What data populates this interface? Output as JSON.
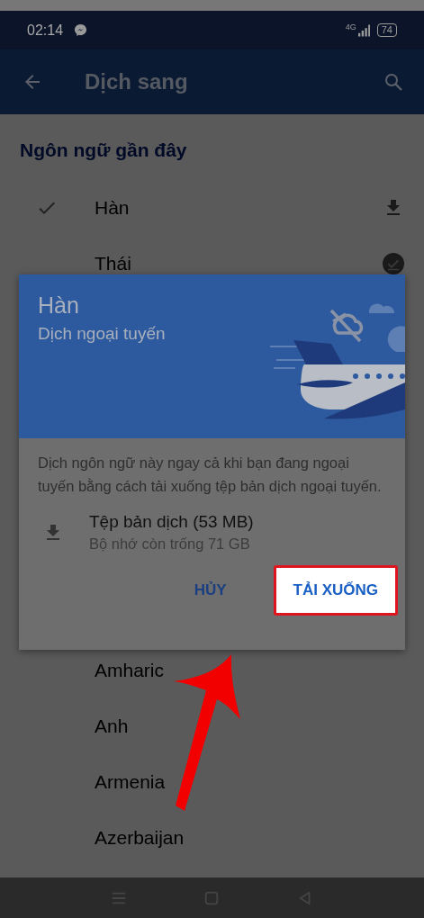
{
  "status_bar": {
    "time": "02:14",
    "network": "4G",
    "battery": "74"
  },
  "app_bar": {
    "title": "Dịch sang"
  },
  "recent_section": {
    "header": "Ngôn ngữ gần đây",
    "items": [
      {
        "name": "Hàn",
        "selected": true,
        "downloaded": false
      },
      {
        "name": "Thái",
        "selected": false,
        "downloaded": true
      }
    ]
  },
  "all_languages": [
    {
      "name": "Amharic"
    },
    {
      "name": "Anh"
    },
    {
      "name": "Armenia"
    },
    {
      "name": "Azerbaijan"
    }
  ],
  "dialog": {
    "title": "Hàn",
    "subtitle": "Dịch ngoại tuyến",
    "description": "Dịch ngôn ngữ này ngay cả khi bạn đang ngoại tuyến bằng cách tải xuống tệp bản dịch ngoại tuyến.",
    "file": {
      "name": "Tệp bản dịch (53 MB)",
      "detail": "Bộ nhớ còn trống 71 GB"
    },
    "buttons": [
      {
        "label": "HỦY",
        "highlighted": false
      },
      {
        "label": "TẢI XUỐNG",
        "highlighted": true
      }
    ]
  }
}
